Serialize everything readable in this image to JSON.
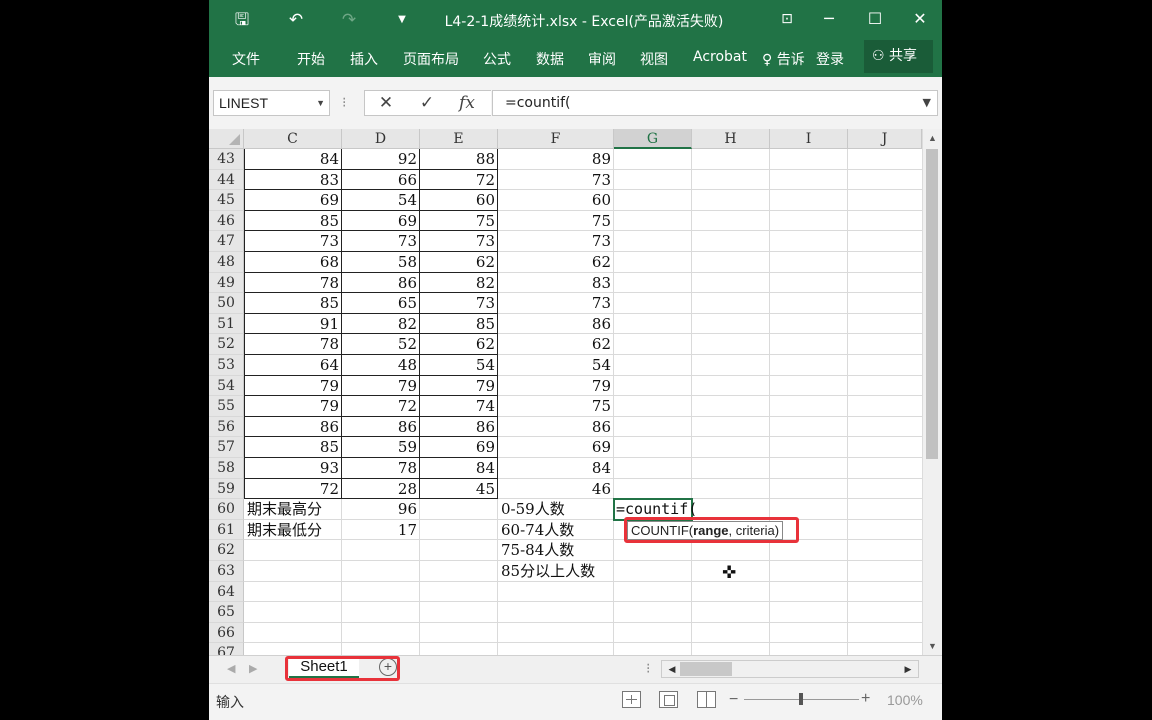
{
  "titlebar": {
    "title": "L4-2-1成绩统计.xlsx - Excel(产品激活失败)",
    "save_icon": "save-icon",
    "undo_icon": "undo-icon",
    "redo_icon": "redo-icon",
    "customize_icon": "customize-qat-icon",
    "ribbon_options_icon": "ribbon-display-options-icon"
  },
  "ribbon": {
    "tabs": [
      "文件",
      "开始",
      "插入",
      "页面布局",
      "公式",
      "数据",
      "审阅",
      "视图",
      "Acrobat"
    ],
    "tell_me": "告诉",
    "login": "登录",
    "share": "共享",
    "accent": "#217346"
  },
  "formula_bar": {
    "name_box": "LINEST",
    "fx": "fx",
    "formula": "=countif("
  },
  "columns": [
    "C",
    "D",
    "E",
    "F",
    "G",
    "H",
    "I",
    "J"
  ],
  "selected_column": "G",
  "rows": [
    {
      "n": "43",
      "c": "84",
      "d": "92",
      "e": "88",
      "f": "89"
    },
    {
      "n": "44",
      "c": "83",
      "d": "66",
      "e": "72",
      "f": "73"
    },
    {
      "n": "45",
      "c": "69",
      "d": "54",
      "e": "60",
      "f": "60"
    },
    {
      "n": "46",
      "c": "85",
      "d": "69",
      "e": "75",
      "f": "75"
    },
    {
      "n": "47",
      "c": "73",
      "d": "73",
      "e": "73",
      "f": "73"
    },
    {
      "n": "48",
      "c": "68",
      "d": "58",
      "e": "62",
      "f": "62"
    },
    {
      "n": "49",
      "c": "78",
      "d": "86",
      "e": "82",
      "f": "83"
    },
    {
      "n": "50",
      "c": "85",
      "d": "65",
      "e": "73",
      "f": "73"
    },
    {
      "n": "51",
      "c": "91",
      "d": "82",
      "e": "85",
      "f": "86"
    },
    {
      "n": "52",
      "c": "78",
      "d": "52",
      "e": "62",
      "f": "62"
    },
    {
      "n": "53",
      "c": "64",
      "d": "48",
      "e": "54",
      "f": "54"
    },
    {
      "n": "54",
      "c": "79",
      "d": "79",
      "e": "79",
      "f": "79"
    },
    {
      "n": "55",
      "c": "79",
      "d": "72",
      "e": "74",
      "f": "75"
    },
    {
      "n": "56",
      "c": "86",
      "d": "86",
      "e": "86",
      "f": "86"
    },
    {
      "n": "57",
      "c": "85",
      "d": "59",
      "e": "69",
      "f": "69"
    },
    {
      "n": "58",
      "c": "93",
      "d": "78",
      "e": "84",
      "f": "84"
    },
    {
      "n": "59",
      "c": "72",
      "d": "28",
      "e": "45",
      "f": "46"
    },
    {
      "n": "60",
      "c": "期末最高分",
      "d": "96",
      "e": "",
      "f": "0-59人数",
      "g": "=countif("
    },
    {
      "n": "61",
      "c": "期末最低分",
      "d": "17",
      "e": "",
      "f": "60-74人数"
    },
    {
      "n": "62",
      "c": "",
      "d": "",
      "e": "",
      "f": "75-84人数"
    },
    {
      "n": "63",
      "c": "",
      "d": "",
      "e": "",
      "f": "85分以上人数"
    },
    {
      "n": "64"
    },
    {
      "n": "65"
    },
    {
      "n": "66"
    },
    {
      "n": "67"
    }
  ],
  "tooltip": {
    "fn": "COUNTIF(",
    "arg1": "range",
    "rest": ", criteria)"
  },
  "sheets": [
    "Sheet1"
  ],
  "status": {
    "mode": "输入",
    "zoom": "100%"
  },
  "highlight_color": "#e8323a"
}
